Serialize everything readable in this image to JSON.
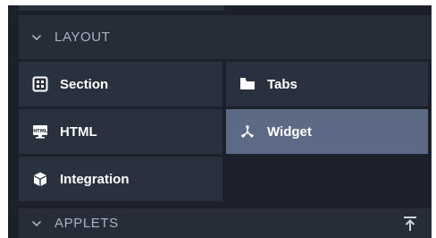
{
  "layout_section": {
    "title": "LAYOUT",
    "expanded": true,
    "items": [
      {
        "label": "Section",
        "icon": "section-grid-icon",
        "selected": false
      },
      {
        "label": "Tabs",
        "icon": "folder-tabs-icon",
        "selected": false
      },
      {
        "label": "HTML",
        "icon": "html-monitor-icon",
        "selected": false
      },
      {
        "label": "Widget",
        "icon": "widget-fan-icon",
        "selected": true
      },
      {
        "label": "Integration",
        "icon": "cube-icon",
        "selected": false
      }
    ]
  },
  "applets_section": {
    "title": "APPLETS",
    "expanded": true,
    "action_icon": "scroll-to-top-icon"
  },
  "colors": {
    "panel_bg": "#1b202b",
    "tile_bg": "#2a313e",
    "tile_selected_bg": "#5d6a85",
    "header_text": "#aab3c4",
    "tile_text": "#ffffff"
  }
}
